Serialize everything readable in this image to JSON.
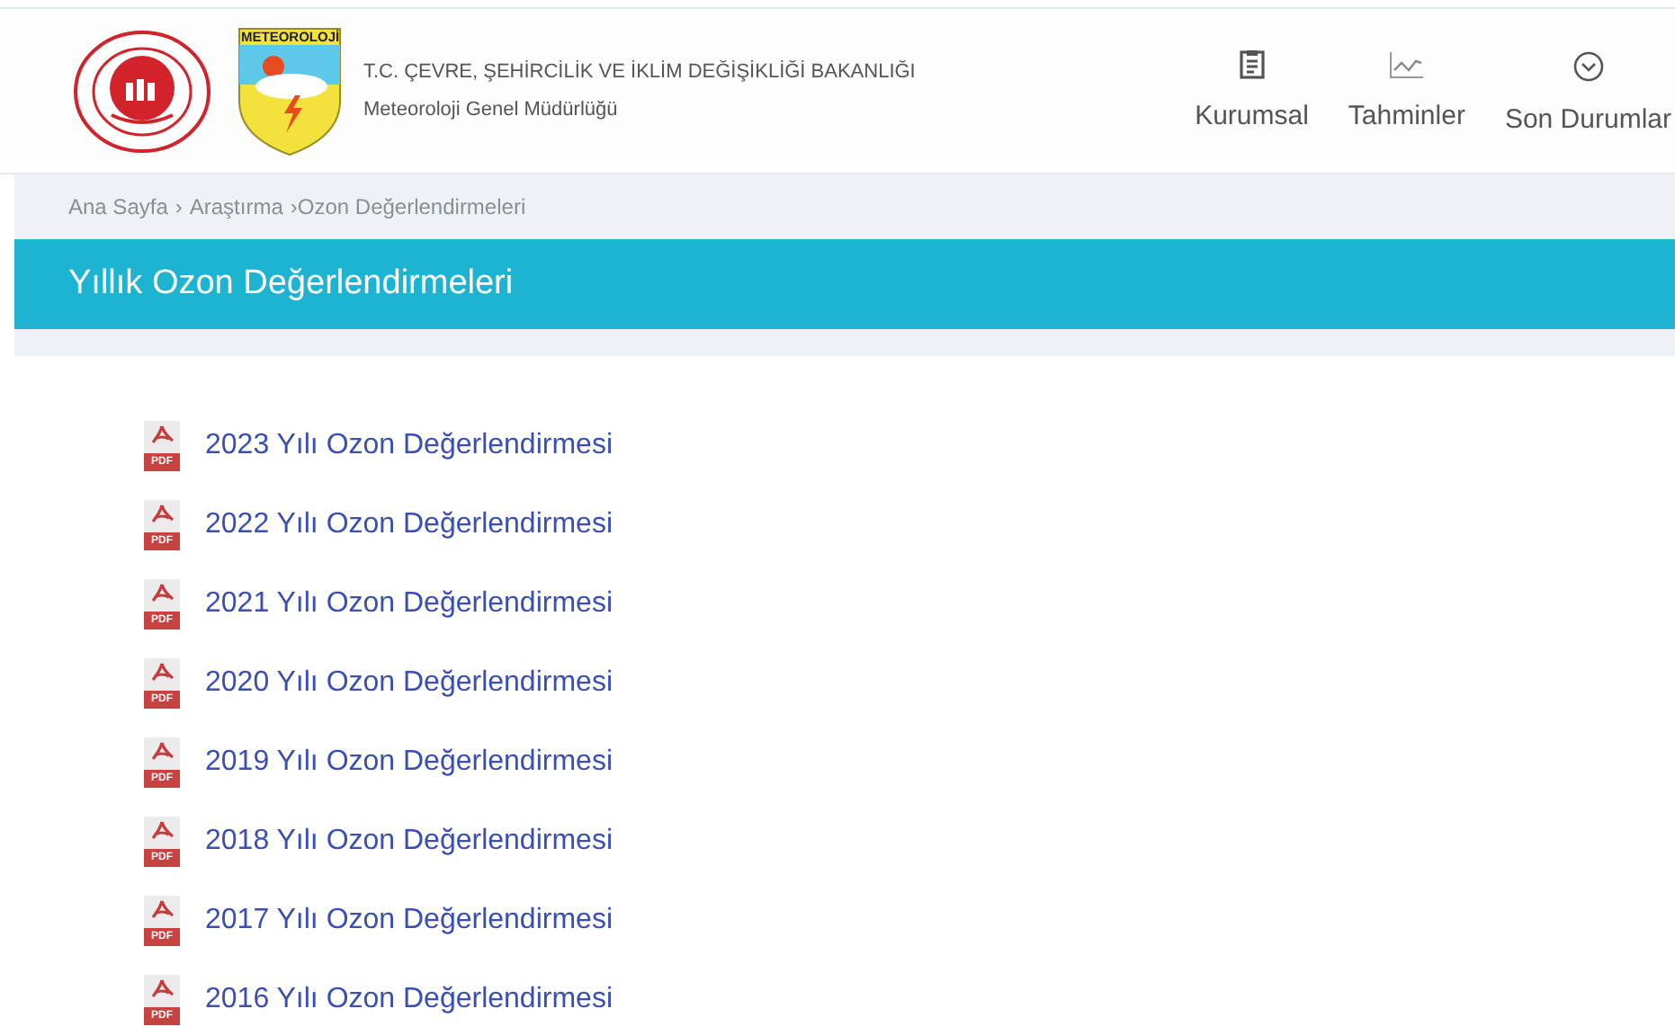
{
  "header": {
    "logo_text": "METEOROLOJİ",
    "ministry": "T.C. ÇEVRE, ŞEHİRCİLİK VE İKLİM DEĞİŞİKLİĞİ BAKANLIĞI",
    "agency": "Meteoroloji Genel Müdürlüğü"
  },
  "nav": [
    {
      "kind": "document",
      "label": "Kurumsal"
    },
    {
      "kind": "chart",
      "label": "Tahminler"
    },
    {
      "kind": "circle",
      "label": "Son Durumlar"
    }
  ],
  "breadcrumb": [
    "Ana Sayfa",
    "›",
    "Araştırma",
    "›Ozon Değerlendirmeleri"
  ],
  "page_title": "Yıllık Ozon Değerlendirmeleri",
  "documents": [
    {
      "icon_label": "PDF",
      "title": "2023 Yılı Ozon Değerlendirmesi"
    },
    {
      "icon_label": "PDF",
      "title": "2022 Yılı Ozon Değerlendirmesi"
    },
    {
      "icon_label": "PDF",
      "title": "2021 Yılı Ozon Değerlendirmesi"
    },
    {
      "icon_label": "PDF",
      "title": "2020 Yılı Ozon Değerlendirmesi"
    },
    {
      "icon_label": "PDF",
      "title": "2019 Yılı Ozon Değerlendirmesi"
    },
    {
      "icon_label": "PDF",
      "title": "2018 Yılı Ozon Değerlendirmesi"
    },
    {
      "icon_label": "PDF",
      "title": "2017 Yılı Ozon Değerlendirmesi"
    },
    {
      "icon_label": "PDF",
      "title": "2016 Yılı Ozon Değerlendirmesi"
    }
  ]
}
